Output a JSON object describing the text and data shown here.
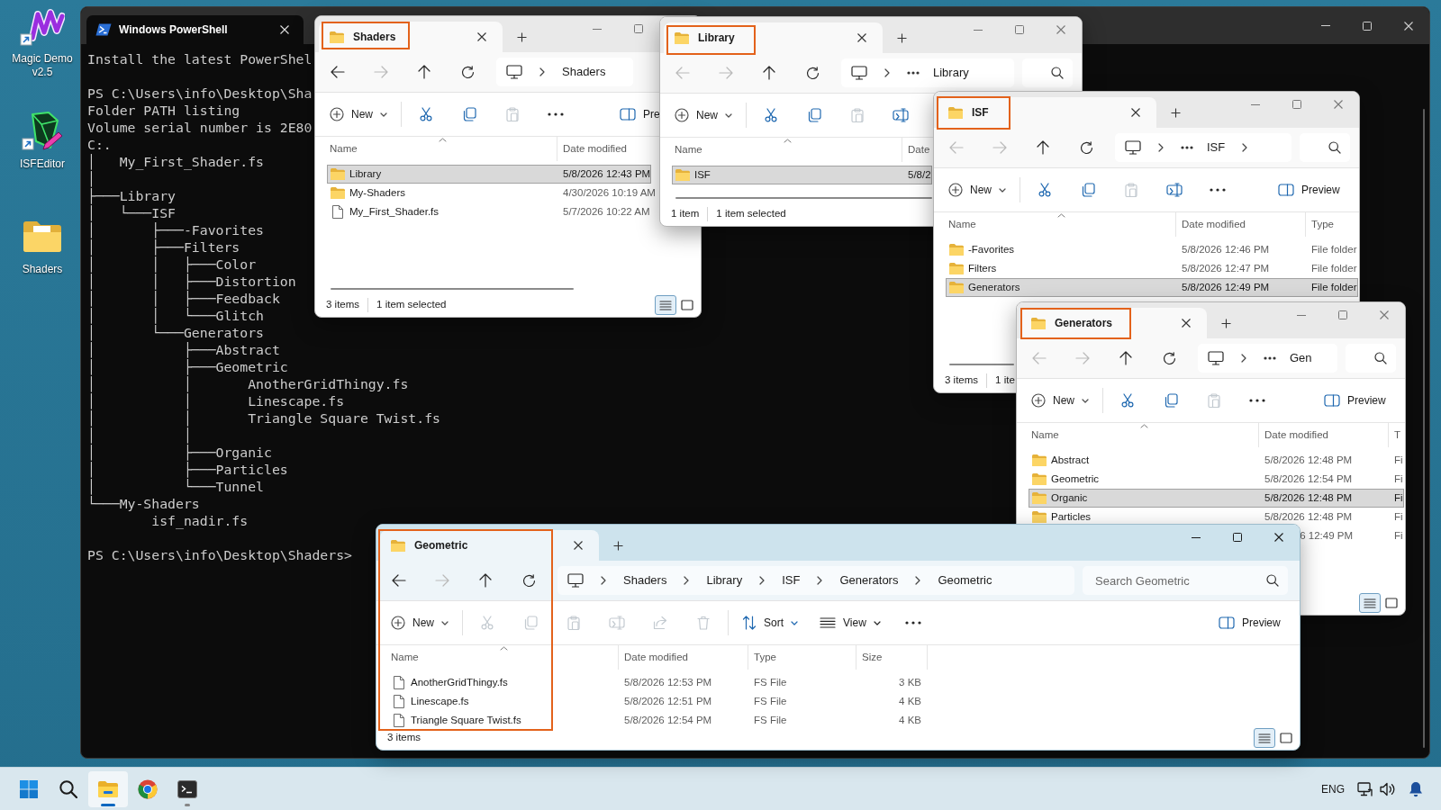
{
  "desktop": {
    "icons": [
      {
        "kind": "zigzag",
        "label": "Magic Demo v2.5",
        "shortcut": true
      },
      {
        "kind": "editor",
        "label": "ISFEditor",
        "shortcut": true
      },
      {
        "kind": "folder",
        "label": "Shaders",
        "shortcut": false
      }
    ]
  },
  "terminal": {
    "tabs": [
      {
        "title": "Windows PowerShell",
        "selected": true
      }
    ],
    "blocks": [
      [
        "Install the latest PowerShel"
      ],
      [
        "PS C:\\Users\\info\\Desktop\\Sha",
        "Folder PATH listing",
        "Volume serial number is 2E80",
        "C:.",
        "│   My_First_Shader.fs",
        "│",
        "├───Library",
        "│   └───ISF",
        "│       ├───-Favorites",
        "│       ├───Filters",
        "│       │   ├───Color",
        "│       │   ├───Distortion",
        "│       │   ├───Feedback",
        "│       │   └───Glitch",
        "│       └───Generators",
        "│           ├───Abstract",
        "│           ├───Geometric",
        "│           │       AnotherGridThingy.fs",
        "│           │       Linescape.fs",
        "│           │       Triangle Square Twist.fs",
        "│           │",
        "│           ├───Organic",
        "│           ├───Particles",
        "│           └───Tunnel",
        "└───My-Shaders",
        "        isf_nadir.fs"
      ],
      [
        "PS C:\\Users\\info\\Desktop\\Shaders>"
      ]
    ]
  },
  "explorer_windows": [
    {
      "active": false,
      "highlighted": true,
      "tabs": [
        {
          "title": "Shaders",
          "selected": true
        }
      ],
      "window_buttons": [
        {
          "kind": "minimize"
        },
        {
          "kind": "maximize"
        }
      ],
      "nav": [
        {
          "kind": "back",
          "disabled": false
        },
        {
          "kind": "forward",
          "disabled": true
        },
        {
          "kind": "up",
          "disabled": false
        },
        {
          "kind": "refresh",
          "disabled": false
        }
      ],
      "address": {
        "collapsed": false,
        "crumbs": [
          "Shaders"
        ],
        "trailing_chevron": false
      },
      "commands": [
        {
          "kind": "new",
          "label": "New",
          "disabled": false
        },
        {
          "kind": "separator"
        },
        {
          "kind": "cut",
          "disabled": false
        },
        {
          "kind": "copy",
          "disabled": false
        },
        {
          "kind": "paste",
          "disabled": true
        },
        {
          "kind": "more",
          "disabled": false
        }
      ],
      "preview": {
        "label": "Pre"
      },
      "columns": [
        "Name",
        "Date modified"
      ],
      "rows": [
        {
          "kind": "folder",
          "cells": [
            "Library",
            "5/8/2026 12:43 PM"
          ],
          "selected": true
        },
        {
          "kind": "folder",
          "cells": [
            "My-Shaders",
            "4/30/2026 10:19 AM"
          ],
          "selected": false
        },
        {
          "kind": "file",
          "cells": [
            "My_First_Shader.fs",
            "5/7/2026 10:22 AM"
          ],
          "selected": false
        }
      ],
      "scrollbar": true,
      "status": [
        "3 items",
        "1 item selected"
      ],
      "view_buttons": [
        {
          "kind": "details",
          "selected": true
        },
        {
          "kind": "tiles",
          "selected": false
        }
      ]
    },
    {
      "active": false,
      "highlighted": true,
      "tabs": [
        {
          "title": "Library",
          "selected": true
        }
      ],
      "window_buttons": [
        {
          "kind": "minimize"
        },
        {
          "kind": "maximize"
        },
        {
          "kind": "close"
        }
      ],
      "nav": [
        {
          "kind": "back",
          "disabled": true
        },
        {
          "kind": "forward",
          "disabled": true
        },
        {
          "kind": "up",
          "disabled": false
        },
        {
          "kind": "refresh",
          "disabled": false
        }
      ],
      "address": {
        "collapsed": true,
        "crumbs": [
          "Library"
        ],
        "trailing_chevron": false
      },
      "search_box": true,
      "commands": [
        {
          "kind": "new",
          "label": "New",
          "disabled": false
        },
        {
          "kind": "separator"
        },
        {
          "kind": "cut",
          "disabled": false
        },
        {
          "kind": "copy",
          "disabled": false
        },
        {
          "kind": "paste",
          "disabled": true
        },
        {
          "kind": "rename",
          "disabled": false
        }
      ],
      "columns": [
        "Name",
        "Date"
      ],
      "rows": [
        {
          "kind": "folder",
          "cells": [
            "ISF",
            "5/8/2"
          ],
          "selected": true
        }
      ],
      "scrollbar": true,
      "status": [
        "1 item",
        "1 item selected"
      ]
    },
    {
      "active": false,
      "highlighted": true,
      "tabs": [
        {
          "title": "ISF",
          "selected": true
        }
      ],
      "window_buttons": [
        {
          "kind": "minimize"
        },
        {
          "kind": "maximize"
        },
        {
          "kind": "close"
        }
      ],
      "nav": [
        {
          "kind": "back",
          "disabled": true
        },
        {
          "kind": "forward",
          "disabled": true
        },
        {
          "kind": "up",
          "disabled": false
        },
        {
          "kind": "refresh",
          "disabled": false
        }
      ],
      "address": {
        "collapsed": true,
        "crumbs": [
          "ISF"
        ],
        "trailing_chevron": true
      },
      "search_box": true,
      "commands": [
        {
          "kind": "new",
          "label": "New",
          "disabled": false
        },
        {
          "kind": "separator"
        },
        {
          "kind": "cut",
          "disabled": false
        },
        {
          "kind": "copy",
          "disabled": false
        },
        {
          "kind": "paste",
          "disabled": true
        },
        {
          "kind": "rename",
          "disabled": false
        },
        {
          "kind": "more",
          "disabled": false
        }
      ],
      "preview": {
        "label": "Preview"
      },
      "columns": [
        "Name",
        "Date modified",
        "Type"
      ],
      "rows": [
        {
          "kind": "folder",
          "cells": [
            "-Favorites",
            "5/8/2026 12:46 PM",
            "File folder"
          ],
          "selected": false
        },
        {
          "kind": "folder",
          "cells": [
            "Filters",
            "5/8/2026 12:47 PM",
            "File folder"
          ],
          "selected": false
        },
        {
          "kind": "folder",
          "cells": [
            "Generators",
            "5/8/2026 12:49 PM",
            "File folder"
          ],
          "selected": true
        }
      ],
      "scrollbar": true,
      "status": [
        "3 items",
        "1 ite"
      ]
    },
    {
      "active": false,
      "highlighted": true,
      "tabs": [
        {
          "title": "Generators",
          "selected": true
        }
      ],
      "window_buttons": [
        {
          "kind": "minimize"
        },
        {
          "kind": "maximize"
        },
        {
          "kind": "close"
        }
      ],
      "nav": [
        {
          "kind": "back",
          "disabled": true
        },
        {
          "kind": "forward",
          "disabled": true
        },
        {
          "kind": "up",
          "disabled": false
        },
        {
          "kind": "refresh",
          "disabled": false
        }
      ],
      "address": {
        "collapsed": true,
        "crumbs": [
          "Gen"
        ],
        "trailing_chevron": false
      },
      "search_box": true,
      "commands": [
        {
          "kind": "new",
          "label": "New",
          "disabled": false
        },
        {
          "kind": "separator"
        },
        {
          "kind": "cut",
          "disabled": false
        },
        {
          "kind": "copy",
          "disabled": false
        },
        {
          "kind": "paste",
          "disabled": true
        },
        {
          "kind": "more",
          "disabled": false
        }
      ],
      "preview": {
        "label": "Preview"
      },
      "columns": [
        "Name",
        "Date modified",
        "T"
      ],
      "rows": [
        {
          "kind": "folder",
          "cells": [
            "Abstract",
            "5/8/2026 12:48 PM",
            "Fi"
          ],
          "selected": false
        },
        {
          "kind": "folder",
          "cells": [
            "Geometric",
            "5/8/2026 12:54 PM",
            "Fi"
          ],
          "selected": false
        },
        {
          "kind": "folder",
          "cells": [
            "Organic",
            "5/8/2026 12:48 PM",
            "Fi"
          ],
          "selected": true
        },
        {
          "kind": "folder",
          "cells": [
            "Particles",
            "5/8/2026 12:48 PM",
            "Fi"
          ],
          "selected": false
        }
      ],
      "partial_row": {
        "date": "6 12:49 PM",
        "type": "Fi"
      },
      "view_buttons": [
        {
          "kind": "details",
          "selected": true
        },
        {
          "kind": "tiles",
          "selected": false
        }
      ]
    },
    {
      "active": true,
      "highlighted": true,
      "tabs": [
        {
          "title": "Geometric",
          "selected": true
        }
      ],
      "window_buttons": [
        {
          "kind": "minimize"
        },
        {
          "kind": "maximize"
        },
        {
          "kind": "close"
        }
      ],
      "nav": [
        {
          "kind": "back",
          "disabled": false
        },
        {
          "kind": "forward",
          "disabled": true
        },
        {
          "kind": "up",
          "disabled": false
        },
        {
          "kind": "refresh",
          "disabled": false
        }
      ],
      "address": {
        "collapsed": false,
        "crumbs": [
          "Shaders",
          "Library",
          "ISF",
          "Generators",
          "Geometric"
        ],
        "trailing_chevron": false
      },
      "search_box": true,
      "search_placeholder": "Search Geometric",
      "commands": [
        {
          "kind": "new",
          "label": "New",
          "disabled": false
        },
        {
          "kind": "separator"
        },
        {
          "kind": "cut",
          "disabled": true
        },
        {
          "kind": "copy",
          "disabled": true
        },
        {
          "kind": "paste",
          "disabled": true
        },
        {
          "kind": "rename",
          "disabled": true
        },
        {
          "kind": "share",
          "disabled": true
        },
        {
          "kind": "delete",
          "disabled": true
        },
        {
          "kind": "separator"
        },
        {
          "kind": "sort",
          "label": "Sort",
          "disabled": false
        },
        {
          "kind": "view",
          "label": "View",
          "disabled": false
        },
        {
          "kind": "more",
          "disabled": false
        }
      ],
      "preview": {
        "label": "Preview"
      },
      "columns": [
        "Name",
        "Date modified",
        "Type",
        "Size"
      ],
      "rows": [
        {
          "kind": "file",
          "cells": [
            "AnotherGridThingy.fs",
            "5/8/2026 12:53 PM",
            "FS File",
            "3 KB"
          ],
          "selected": false
        },
        {
          "kind": "file",
          "cells": [
            "Linescape.fs",
            "5/8/2026 12:51 PM",
            "FS File",
            "4 KB"
          ],
          "selected": false
        },
        {
          "kind": "file",
          "cells": [
            "Triangle Square Twist.fs",
            "5/8/2026 12:54 PM",
            "FS File",
            "4 KB"
          ],
          "selected": false
        }
      ],
      "status": [
        "3 items"
      ],
      "view_buttons": [
        {
          "kind": "details",
          "selected": true
        },
        {
          "kind": "tiles",
          "selected": false
        }
      ]
    }
  ],
  "taskbar": {
    "apps": [
      {
        "kind": "start",
        "active": false,
        "running": false
      },
      {
        "kind": "search",
        "active": false,
        "running": false
      },
      {
        "kind": "explorer",
        "active": true,
        "running": true
      },
      {
        "kind": "browser",
        "active": false,
        "running": false
      },
      {
        "kind": "terminal",
        "active": false,
        "running": true
      }
    ],
    "language": "ENG"
  }
}
